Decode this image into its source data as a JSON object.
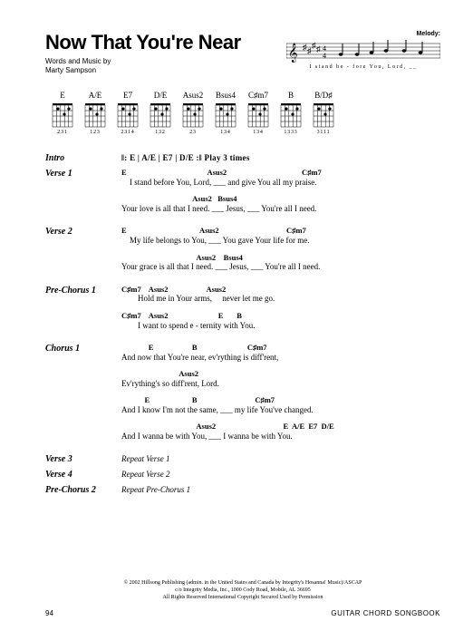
{
  "title": "Now That You're Near",
  "byline1": "Words and Music by",
  "byline2": "Marty Sampson",
  "melody_label": "Melody:",
  "melody_lyrics": "I   stand  be  -  fore    You,   Lord, __",
  "chords": [
    {
      "name": "E",
      "fingers": "231"
    },
    {
      "name": "A/E",
      "fingers": "123"
    },
    {
      "name": "E7",
      "fingers": "2314"
    },
    {
      "name": "D/E",
      "fingers": "132"
    },
    {
      "name": "Asus2",
      "fingers": "23"
    },
    {
      "name": "Bsus4",
      "fingers": "134"
    },
    {
      "name": "C♯m7",
      "fingers": "134"
    },
    {
      "name": "B",
      "fingers": "1333"
    },
    {
      "name": "B/D♯",
      "fingers": "3111"
    }
  ],
  "sections": [
    {
      "label": "Intro",
      "type": "intro",
      "text": "‖: E          | A/E       | E7         | D/E       :‖  Play 3 times"
    },
    {
      "label": "Verse 1",
      "type": "lyrics",
      "lines": [
        {
          "ch": "E                                          Asus2                                       C♯m7",
          "ly": "    I stand before You, Lord, ___ and give You all my praise."
        },
        {
          "ch": "                                     Asus2   Bsus4",
          "ly": "Your love is all that I need. ___ Jesus, ___ You're all I need."
        }
      ]
    },
    {
      "label": "Verse 2",
      "type": "lyrics",
      "lines": [
        {
          "ch": "E                                      Asus2                                   C♯m7",
          "ly": "    My life belongs to You, ___ You gave Your life for me."
        },
        {
          "ch": "                                       Asus2    Bsus4",
          "ly": "Your grace is all that I need. ___ Jesus, ___ You're all I need."
        }
      ]
    },
    {
      "label": "Pre-Chorus 1",
      "type": "lyrics",
      "lines": [
        {
          "ch": "C♯m7    Asus2                    Asus2",
          "ly": "        Hold me in Your arms,     never let me go."
        },
        {
          "ch": "C♯m7    Asus2                          E       B",
          "ly": "        I want to spend e - ternity with You."
        }
      ]
    },
    {
      "label": "Chorus 1",
      "type": "lyrics",
      "lines": [
        {
          "ch": "              E                    B                          C♯m7",
          "ly": "And now that You're near, ev'rything is diff'rent,"
        },
        {
          "ch": "                              Asus2",
          "ly": "Ev'rything's so diff'rent, Lord."
        },
        {
          "ch": "            E                      B                              C♯m7",
          "ly": "And I know I'm not the same, ___ my life You've changed."
        },
        {
          "ch": "                                       Asus2                                   E  A/E  E7  D/E",
          "ly": "And I wanna be with You, ___ I wanna be with You."
        }
      ]
    },
    {
      "label": "Verse 3",
      "type": "repeat",
      "text": "Repeat Verse 1"
    },
    {
      "label": "Verse 4",
      "type": "repeat",
      "text": "Repeat Verse 2"
    },
    {
      "label": "Pre-Chorus 2",
      "type": "repeat",
      "text": "Repeat Pre-Chorus 1"
    }
  ],
  "copyright": "© 2002 Hillsong Publishing (admin. in the United States and Canada by Integrity's Hosanna! Music)/ASCAP\nc/o Integrity Media, Inc., 1000 Cody Road, Mobile, AL 36695\nAll Rights Reserved   International Copyright Secured   Used by Permission",
  "page_number": "94",
  "book_label": "GUITAR CHORD SONGBOOK"
}
